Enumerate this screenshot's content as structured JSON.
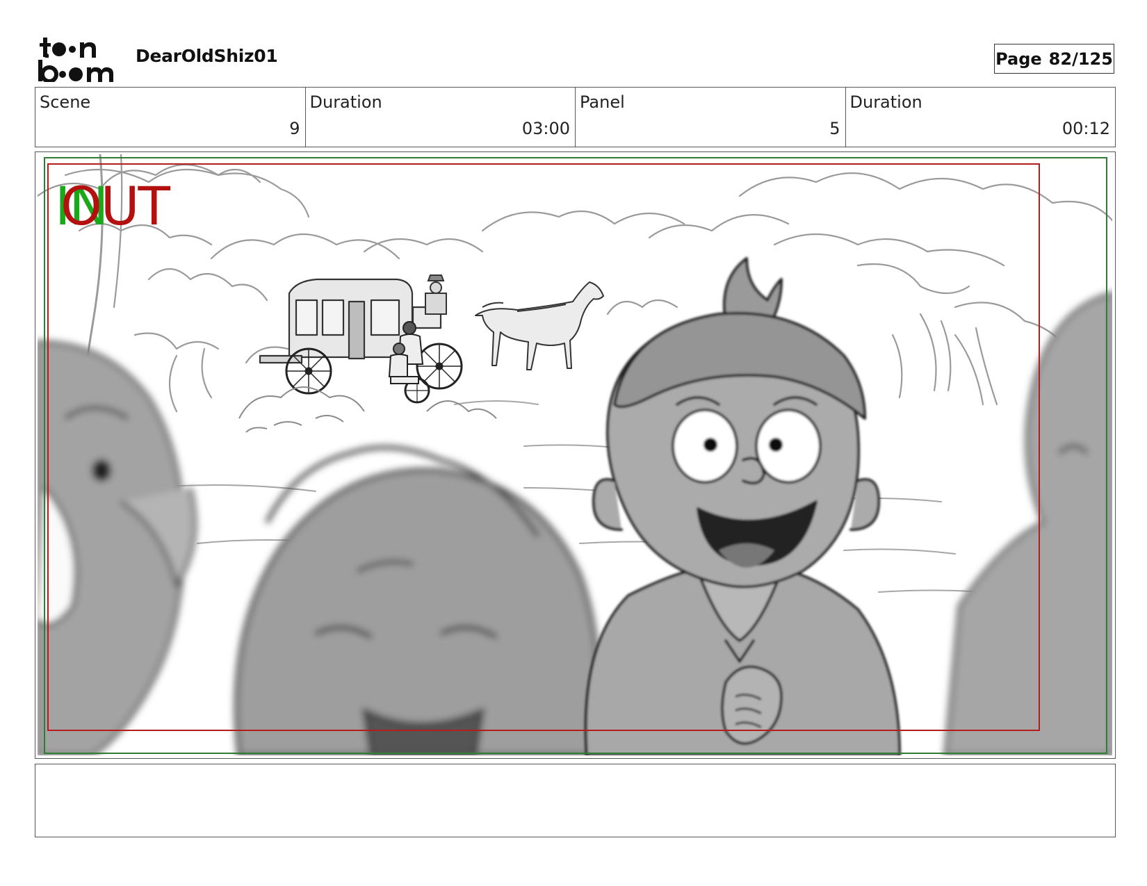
{
  "header": {
    "project_title": "DearOldShiz01",
    "page_label": "Page",
    "page_number": "82/125",
    "logo_icon": "toonboom-logo-icon"
  },
  "info_table": {
    "scene": {
      "label": "Scene",
      "value": "9"
    },
    "scene_duration": {
      "label": "Duration",
      "value": "03:00"
    },
    "panel": {
      "label": "Panel",
      "value": "5"
    },
    "panel_duration": {
      "label": "Duration",
      "value": "00:12"
    }
  },
  "panel": {
    "in_marker": "IN",
    "out_marker": "OUT",
    "colors": {
      "in_marker": "#1aa81a",
      "out_marker": "#b31010",
      "safe_frame_outer": "#2e7d32",
      "safe_frame_inner": "#b71c1c"
    }
  },
  "notes": {
    "text": ""
  }
}
